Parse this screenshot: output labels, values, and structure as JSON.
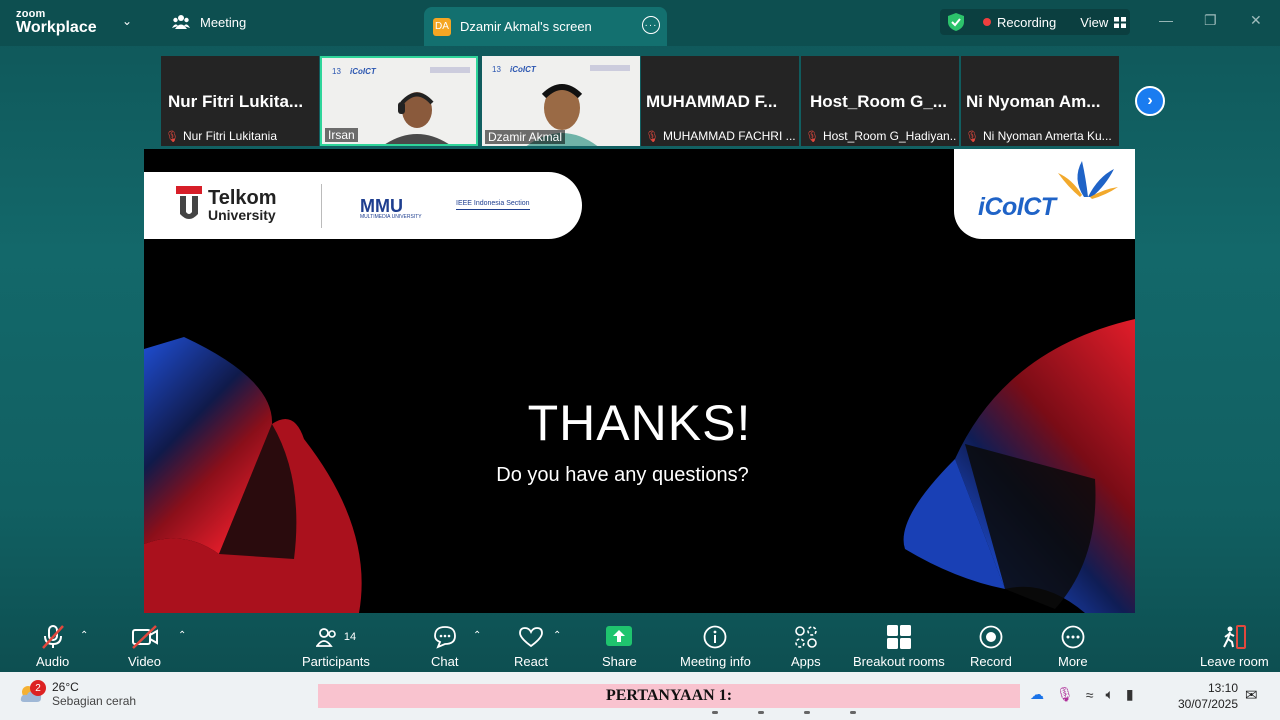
{
  "app": {
    "logo_line1": "zoom",
    "logo_line2": "Workplace",
    "meeting_tab": "Meeting",
    "screen_tab": "Dzamir Akmal's screen",
    "screen_tab_badge": "DA",
    "recording_label": "Recording",
    "view_label": "View"
  },
  "participants_strip": [
    {
      "big_name": "Nur Fitri Lukita...",
      "label": "Nur Fitri Lukitania",
      "muted": true,
      "video": false
    },
    {
      "label": "Irsan",
      "video": true,
      "active_speaker": true
    },
    {
      "label": "Dzamir Akmal",
      "video": true
    },
    {
      "big_name": "MUHAMMAD F...",
      "label": "MUHAMMAD FACHRI ...",
      "muted": true,
      "video": false
    },
    {
      "big_name": "Host_Room G_...",
      "label": "Host_Room G_Hadiyan...",
      "muted": true,
      "video": false
    },
    {
      "big_name": "Ni Nyoman Am...",
      "label": "Ni Nyoman Amerta Ku...",
      "muted": true,
      "video": false
    }
  ],
  "slide": {
    "logo_telkom_1": "Telkom",
    "logo_telkom_2": "University",
    "logo_mmu": "MMU",
    "logo_mmu_sub": "MULTIMEDIA UNIVERSITY",
    "logo_ieee": "IEEE  Indonesia Section",
    "logo_icoict": "iCoICT",
    "heading": "THANKS!",
    "subheading": "Do you have any questions?"
  },
  "toolbar": {
    "audio": "Audio",
    "video": "Video",
    "participants": "Participants",
    "participants_count": "14",
    "chat": "Chat",
    "react": "React",
    "share": "Share",
    "meeting_info": "Meeting info",
    "apps": "Apps",
    "breakout_rooms": "Breakout rooms",
    "record": "Record",
    "more": "More",
    "leave_room": "Leave room"
  },
  "taskbar": {
    "weather_badge": "2",
    "temperature": "26°C",
    "weather_desc": "Sebagian cerah",
    "ticker_text": "PERTANYAAN 1:",
    "time": "13:10",
    "date": "30/07/2025"
  },
  "colors": {
    "accent_green": "#2fd59a",
    "recording_red": "#f03e3e",
    "share_green": "#1fc46e",
    "next_blue": "#1a7cf0"
  }
}
